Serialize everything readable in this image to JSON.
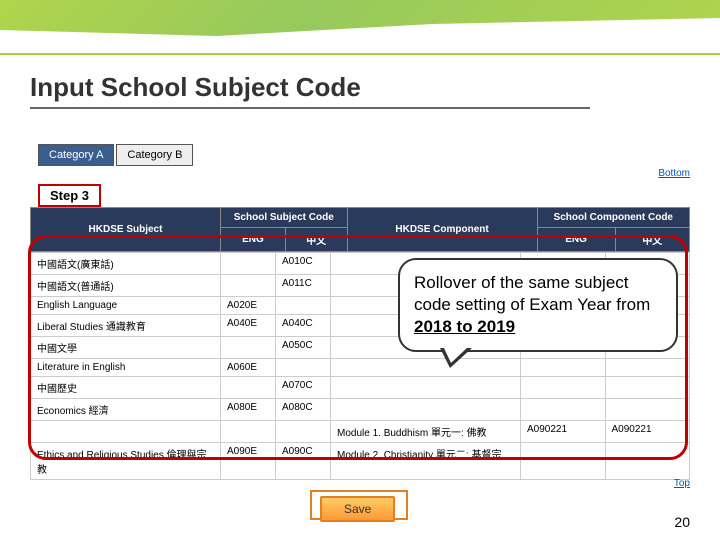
{
  "title": "Input School Subject Code",
  "tabs": {
    "a": "Category A",
    "b": "Category B"
  },
  "links": {
    "bottom": "Bottom",
    "top": "Top"
  },
  "step_label": "Step 3",
  "headers": {
    "hkdse_subject": "HKDSE Subject",
    "school_subject_code": "School Subject Code",
    "hkdse_component": "HKDSE Component",
    "school_component_code": "School Component Code",
    "eng": "ENG",
    "chi": "中文"
  },
  "rows": [
    {
      "subj": "中國語文(廣東話)",
      "eng": "",
      "chi": "A010C",
      "comp": "",
      "ceng": "",
      "cchi": ""
    },
    {
      "subj": "中國語文(普通話)",
      "eng": "",
      "chi": "A011C",
      "comp": "",
      "ceng": "",
      "cchi": ""
    },
    {
      "subj": "English Language",
      "eng": "A020E",
      "chi": "",
      "comp": "",
      "ceng": "",
      "cchi": ""
    },
    {
      "subj": "Liberal Studies 通識教育",
      "eng": "A040E",
      "chi": "A040C",
      "comp": "",
      "ceng": "",
      "cchi": ""
    },
    {
      "subj": "中國文學",
      "eng": "",
      "chi": "A050C",
      "comp": "",
      "ceng": "",
      "cchi": ""
    },
    {
      "subj": "Literature in English",
      "eng": "A060E",
      "chi": "",
      "comp": "",
      "ceng": "",
      "cchi": ""
    },
    {
      "subj": "中國歷史",
      "eng": "",
      "chi": "A070C",
      "comp": "",
      "ceng": "",
      "cchi": ""
    },
    {
      "subj": "Economics 經濟",
      "eng": "A080E",
      "chi": "A080C",
      "comp": "",
      "ceng": "",
      "cchi": ""
    },
    {
      "subj": "",
      "eng": "",
      "chi": "",
      "comp": "Module 1. Buddhism 單元一: 佛教",
      "ceng": "A090221",
      "cchi": "A090221"
    },
    {
      "subj": "Ethics and Religious Studies 倫理與宗教",
      "eng": "A090E",
      "chi": "A090C",
      "comp": "Module 2. Christianity 單元二: 基督宗",
      "ceng": "",
      "cchi": ""
    }
  ],
  "callout": {
    "prefix": "Rollover of the same subject code setting of Exam Year from ",
    "bold": "2018 to 2019"
  },
  "save_label": "Save",
  "page_number": "20"
}
